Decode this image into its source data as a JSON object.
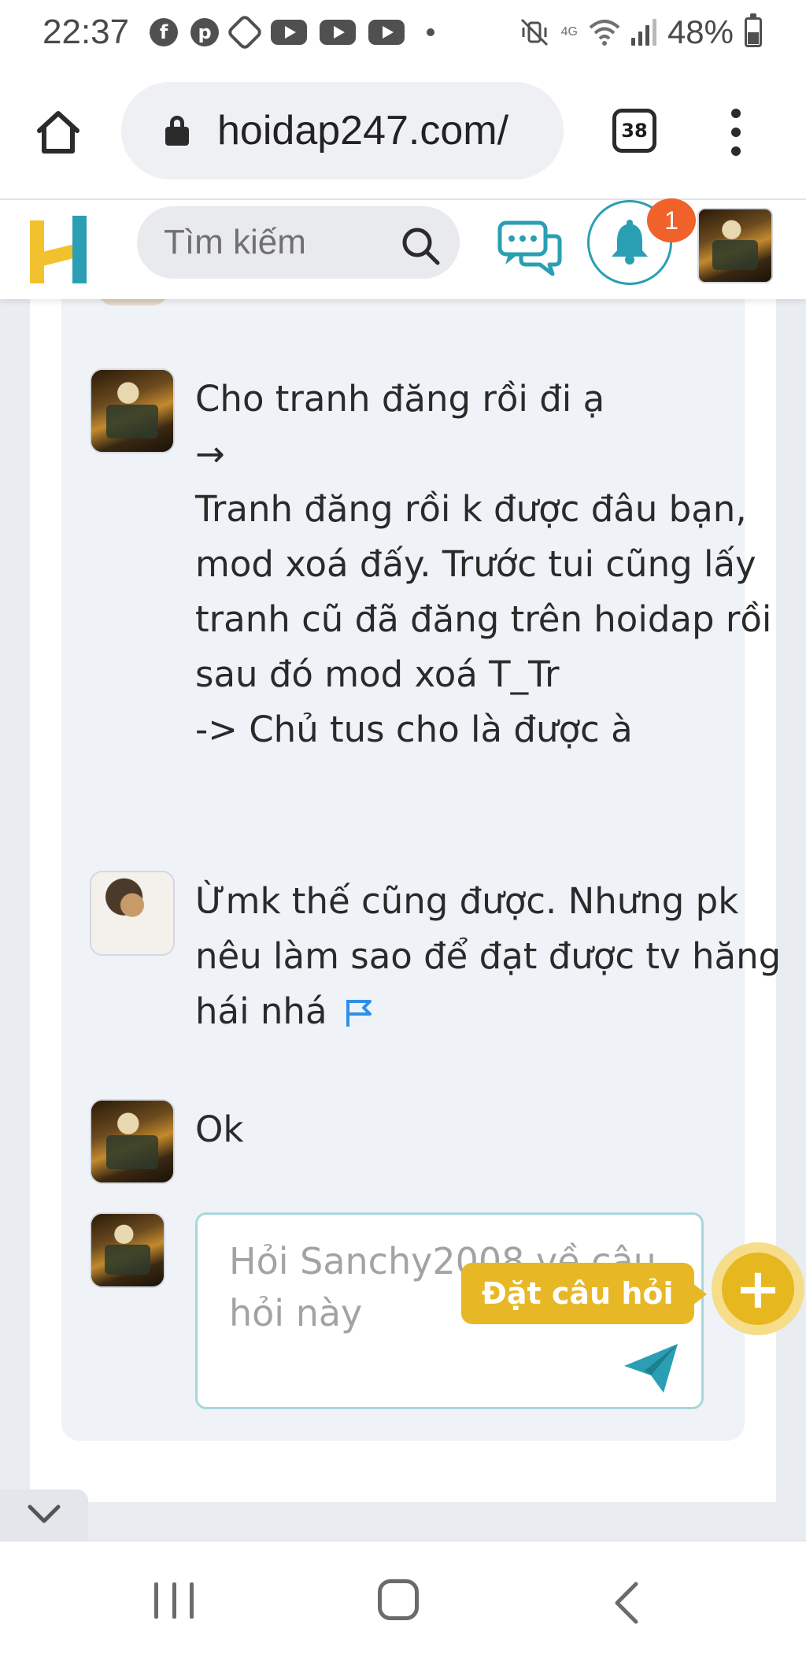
{
  "status_bar": {
    "time": "22:37",
    "battery": "48%",
    "battery_level": 0.48,
    "network_label": "4G",
    "app_icons": [
      "facebook-icon",
      "pinterest-icon",
      "hexagon-app-icon",
      "youtube-icon",
      "youtube-icon",
      "youtube-icon"
    ]
  },
  "browser": {
    "url": "hoidap247.com/",
    "tab_count": "38"
  },
  "site_header": {
    "search_placeholder": "Tìm kiếm",
    "notification_count": "1",
    "logo_colors": {
      "left": "#f2c12e",
      "right": "#2a9fb3"
    }
  },
  "comments": [
    {
      "avatar": "avatar-user-sanchy",
      "text": "Cho tranh đăng rồi đi ạ\n→\n Tranh đăng rồi k được đâu bạn, mod xoá đấy. Trước tui cũng lấy tranh cũ đã đăng trên hoidap rồi sau đó mod xoá T_Tr\n-> Chủ tus cho là được à"
    },
    {
      "avatar": "avatar-user-2",
      "text": "Ừmk thế cũng được. Nhưng pk nêu làm sao để đạt được tv hăng hái nhá",
      "has_flag": true
    },
    {
      "avatar": "avatar-user-sanchy",
      "text": "Ok"
    }
  ],
  "reply": {
    "placeholder": "Hỏi Sanchy2008 về câu hỏi này"
  },
  "ask_button": {
    "label": "Đặt câu hỏi",
    "icon": "+"
  },
  "colors": {
    "accent": "#2a9fb3",
    "ask_yellow": "#e7b726",
    "badge": "#f0622a",
    "panel_bg": "#eff2f7"
  }
}
